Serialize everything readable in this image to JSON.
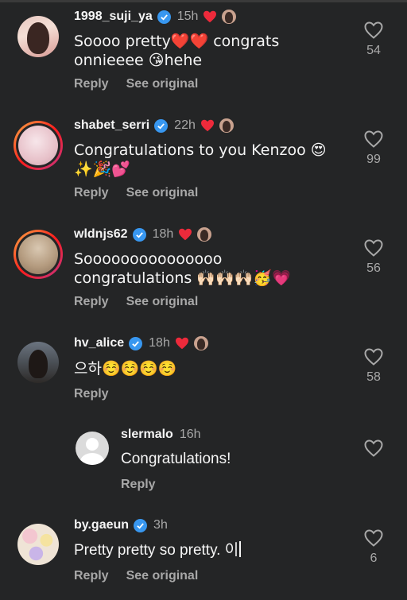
{
  "actions": {
    "reply": "Reply",
    "see_original": "See original"
  },
  "comments": [
    {
      "username": "1998_suji_ya",
      "time": "15h",
      "text": "Soooo pretty❤️❤️ congrats onnieeee 😘hehe",
      "likes": "54",
      "verified": true,
      "author_liked": true
    },
    {
      "username": "shabet_serri",
      "time": "22h",
      "text": "Congratulations to you Kenzoo 😍✨🎉💕",
      "likes": "99",
      "verified": true,
      "author_liked": true
    },
    {
      "username": "wldnjs62",
      "time": "18h",
      "text": "Sooooooooooooooo congratulations 🙌🏻🙌🏻🙌🏻🥳💗",
      "likes": "56",
      "verified": true,
      "author_liked": true
    },
    {
      "username": "hv_alice",
      "time": "18h",
      "text": "으하☺️☺️☺️☺️",
      "likes": "58",
      "verified": true,
      "author_liked": true
    },
    {
      "username": "slermalo",
      "time": "16h",
      "text": "Congratulations!",
      "likes": "",
      "verified": false,
      "author_liked": false
    },
    {
      "username": "by.gaeun",
      "time": "3h",
      "text": "Pretty pretty so pretty. 이",
      "likes": "6",
      "verified": true,
      "author_liked": false
    }
  ],
  "colors": {
    "background": "#242526",
    "secondary_text": "#a8a8a8",
    "verified_blue": "#3897f0",
    "heart_red": "#ed2a3b"
  }
}
